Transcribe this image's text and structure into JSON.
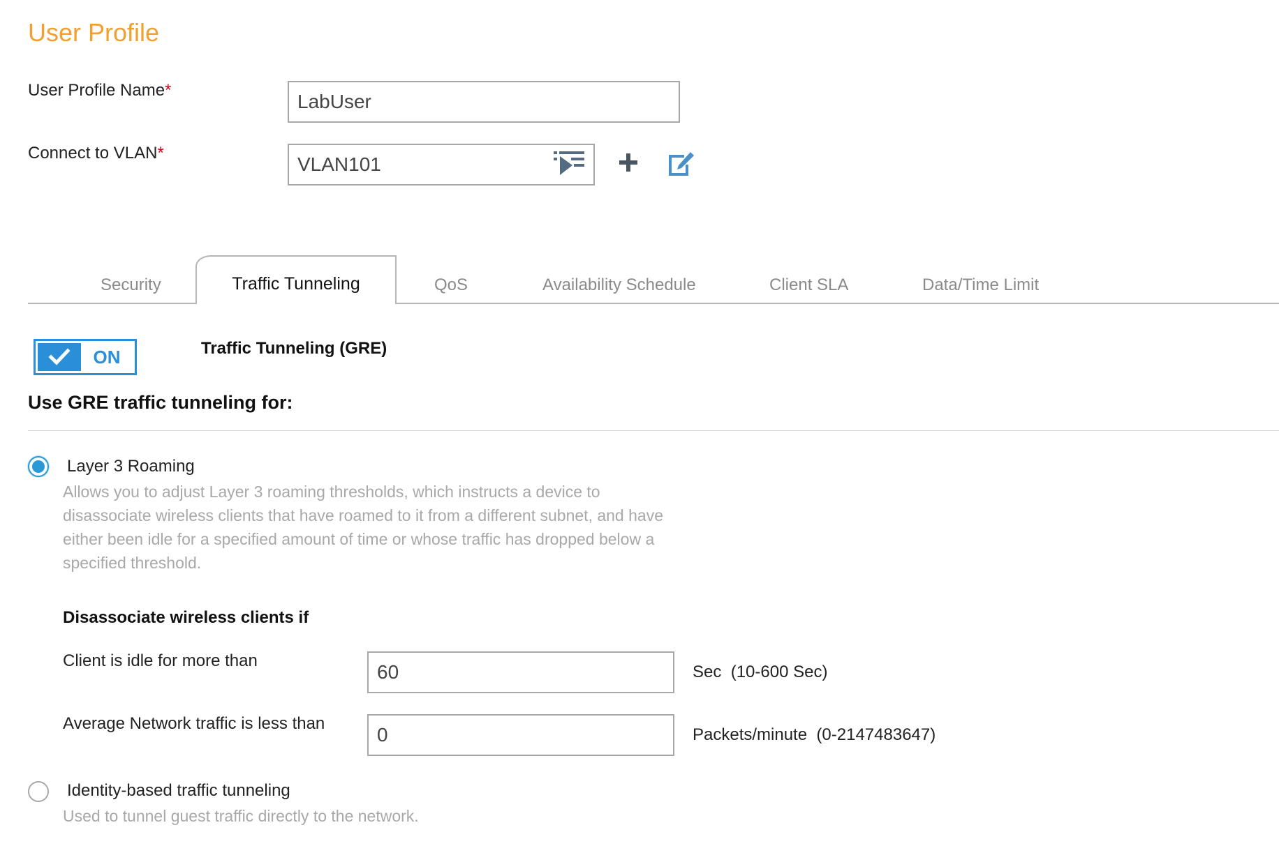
{
  "page_title": "User Profile",
  "fields": {
    "profile_name": {
      "label": "User Profile Name",
      "required_mark": "*",
      "value": "LabUser"
    },
    "vlan": {
      "label": "Connect to VLAN",
      "required_mark": "*",
      "value": "VLAN101"
    }
  },
  "tabs": [
    "Security",
    "Traffic Tunneling",
    "QoS",
    "Availability Schedule",
    "Client SLA",
    "Data/Time Limit"
  ],
  "active_tab": "Traffic Tunneling",
  "toggle": {
    "state": "ON",
    "label": "Traffic Tunneling (GRE)"
  },
  "section_heading": "Use GRE traffic tunneling for:",
  "options": [
    {
      "label": "Layer 3 Roaming",
      "selected": true,
      "description_lines": [
        "Allows you to adjust Layer 3 roaming thresholds, which instructs a device to",
        "disassociate wireless clients that have roamed to it from a different subnet, and have",
        "either been idle for a specified amount of time or whose traffic has dropped below a",
        "specified threshold."
      ]
    },
    {
      "label": "Identity-based traffic tunneling",
      "selected": false,
      "description": "Used to tunnel guest traffic directly to the network."
    }
  ],
  "disassociate": {
    "heading": "Disassociate wireless clients if",
    "idle": {
      "label": "Client is idle for more than",
      "value": "60",
      "unit": "Sec",
      "range": "(10-600 Sec)"
    },
    "traffic": {
      "label": "Average Network traffic is less than",
      "value": "0",
      "unit": "Packets/minute",
      "range": "(0-2147483647)"
    }
  },
  "colors": {
    "title": "#f0a030",
    "accent": "#2a8fd8",
    "required": "#d0021b",
    "muted_text": "#a8a8a8"
  },
  "icons": {
    "vlan_picker": "list-picker-icon",
    "add": "plus-icon",
    "edit": "edit-icon",
    "toggle": "checkmark-icon"
  }
}
